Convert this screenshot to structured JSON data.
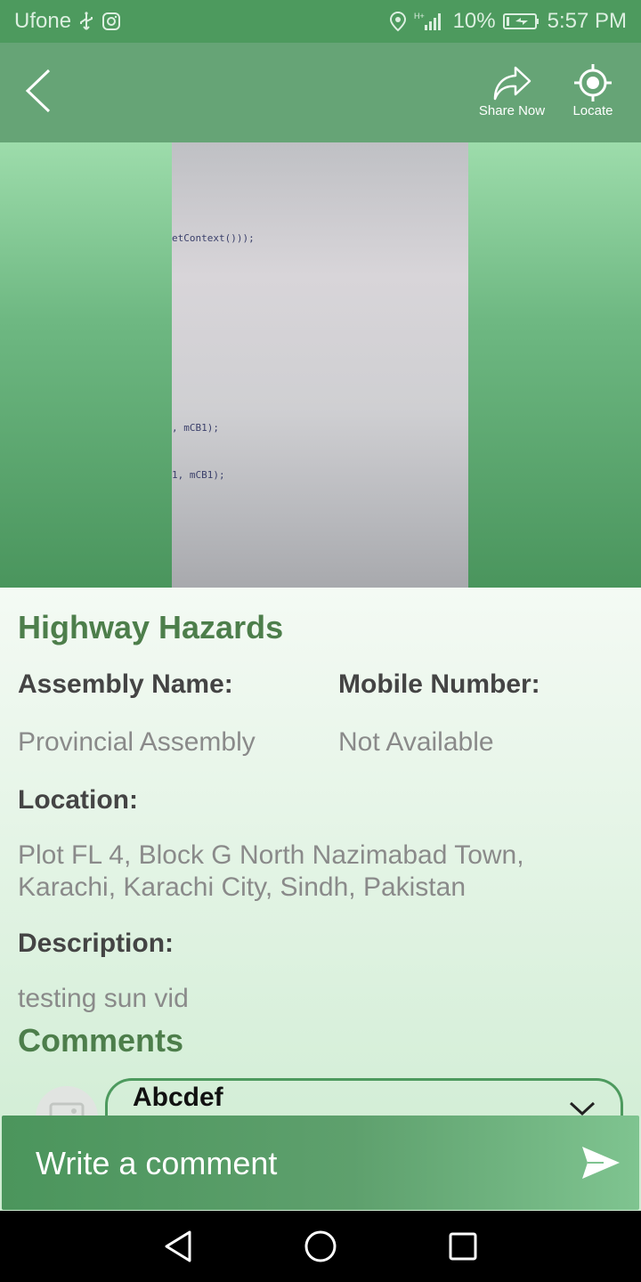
{
  "status_bar": {
    "carrier": "Ufone",
    "network": "H+",
    "battery": "10%",
    "time": "5:57 PM",
    "icons": [
      "usb-icon",
      "instagram-icon",
      "location-pin-icon",
      "signal-icon",
      "battery-charging-icon"
    ]
  },
  "app_bar": {
    "share_label": "Share Now",
    "locate_label": "Locate",
    "icons": [
      "back-arrow-icon",
      "share-icon",
      "locate-icon"
    ]
  },
  "video": {
    "code_lines": [
      "etContext()));",
      ", mCB1);",
      "1, mCB1);"
    ]
  },
  "report": {
    "title": "Highway Hazards",
    "assembly_label": "Assembly Name:",
    "assembly_value": "Provincial Assembly",
    "mobile_label": "Mobile Number:",
    "mobile_value": "Not Available",
    "location_label": "Location:",
    "location_value": "Plot FL 4, Block G North Nazimabad Town, Karachi, Karachi City, Sindh, Pakistan",
    "description_label": "Description:",
    "description_value": "testing sun vid"
  },
  "comments": {
    "heading": "Comments",
    "items": [
      {
        "author": "Abcdef"
      }
    ],
    "input_placeholder": "Write a comment",
    "icons": [
      "image-placeholder-icon",
      "chevron-down-icon",
      "send-icon"
    ]
  },
  "nav_bar": {
    "icons": [
      "back-triangle-icon",
      "home-circle-icon",
      "recents-square-icon"
    ]
  },
  "colors": {
    "primary_green": "#4d9a5e",
    "title_green": "#4d7e4b"
  }
}
